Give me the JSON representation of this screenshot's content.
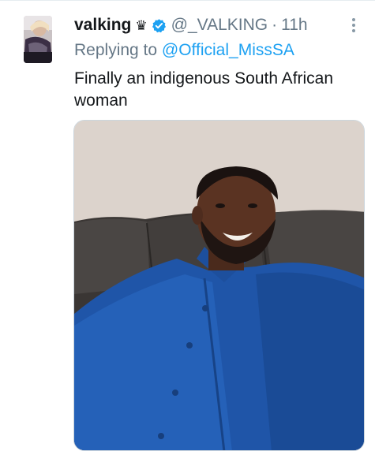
{
  "tweet": {
    "display_name": "valking",
    "name_emoji": "♛",
    "handle": "@_VALKING",
    "separator": "·",
    "time": "11h",
    "replying_prefix": "Replying to ",
    "replying_to": "@Official_MissSA",
    "text": "Finally an indigenous South African woman",
    "verified": true,
    "media_type": "photo"
  },
  "icons": {
    "verified": "verified-badge-icon",
    "more": "more-options-icon"
  },
  "colors": {
    "link": "#1da1f2",
    "secondary_text": "#657786",
    "primary_text": "#14171a",
    "verified_badge": "#1da1f2"
  }
}
